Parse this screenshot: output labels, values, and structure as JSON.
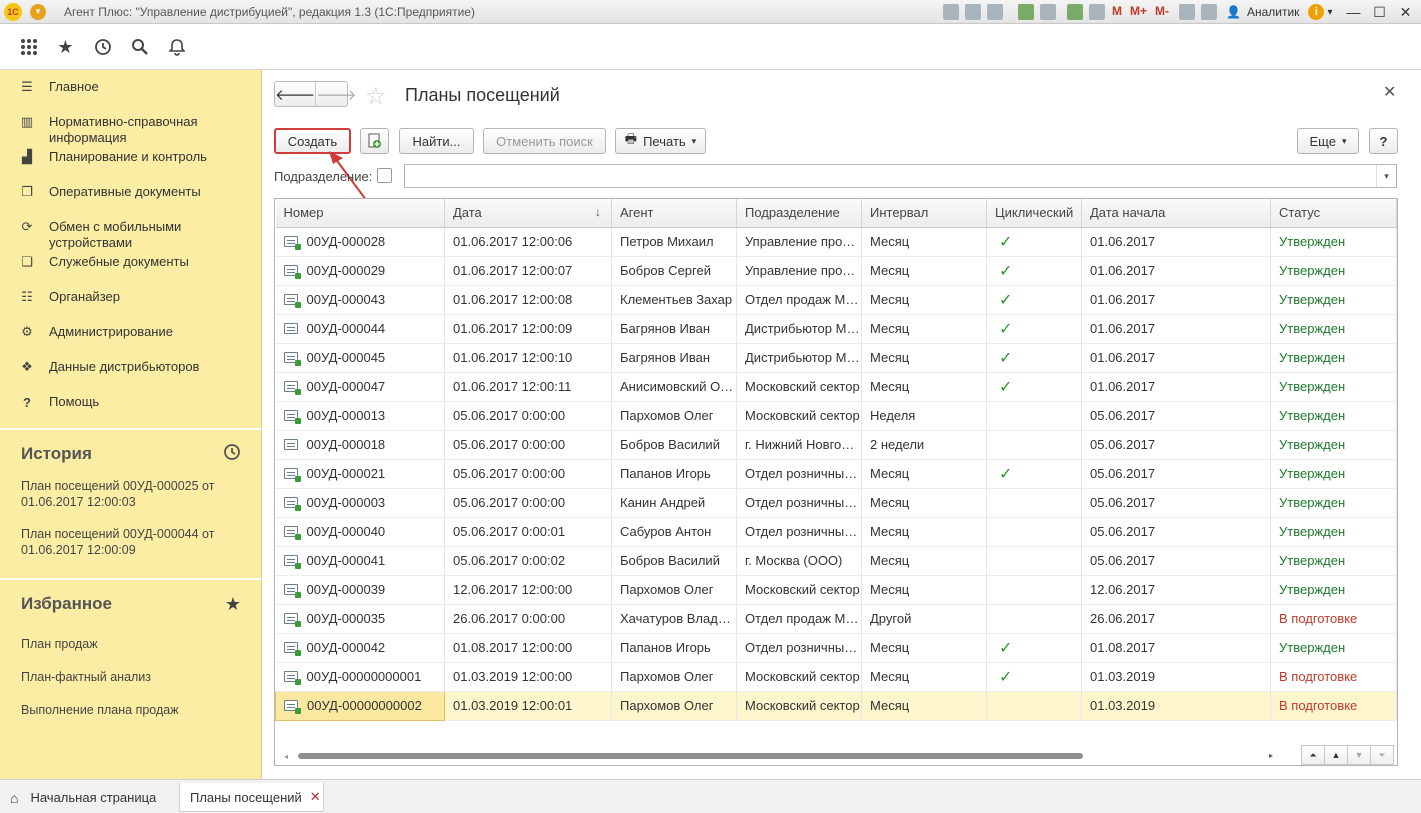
{
  "app": {
    "title": "Агент Плюс: \"Управление дистрибуцией\", редакция 1.3  (1С:Предприятие)",
    "user": "Аналитик",
    "m_labels": [
      "M",
      "M+",
      "M-"
    ]
  },
  "toppanel": {
    "icons": [
      "apps-grid-icon",
      "favorites-star-icon",
      "history-icon",
      "search-icon",
      "notifications-bell-icon"
    ]
  },
  "sidebar": {
    "items": [
      {
        "label": "Главное",
        "icon": "menu-lines-icon"
      },
      {
        "label": "Нормативно-справочная информация",
        "icon": "catalog-icon"
      },
      {
        "label": "Планирование и контроль",
        "icon": "bar-chart-icon"
      },
      {
        "label": "Оперативные документы",
        "icon": "documents-icon"
      },
      {
        "label": "Обмен с мобильными устройствами",
        "icon": "sync-icon"
      },
      {
        "label": "Служебные документы",
        "icon": "service-docs-icon"
      },
      {
        "label": "Органайзер",
        "icon": "organizer-icon"
      },
      {
        "label": "Администрирование",
        "icon": "gear-icon"
      },
      {
        "label": "Данные дистрибьюторов",
        "icon": "distributor-icon"
      },
      {
        "label": "Помощь",
        "icon": "help-icon"
      }
    ],
    "history": {
      "title": "История",
      "items": [
        "План посещений 00УД-000025 от 01.06.2017 12:00:03",
        "План посещений 00УД-000044 от 01.06.2017 12:00:09"
      ]
    },
    "favorites": {
      "title": "Избранное",
      "items": [
        "План продаж",
        "План-фактный анализ",
        "Выполнение плана продаж"
      ]
    }
  },
  "form": {
    "title": "Планы посещений",
    "buttons": {
      "create": "Создать",
      "find": "Найти...",
      "cancel_search": "Отменить поиск",
      "print": "Печать",
      "more": "Еще",
      "help": "?"
    },
    "filter_label": "Подразделение:",
    "filter_value": ""
  },
  "table": {
    "columns": [
      "Номер",
      "Дата",
      "Агент",
      "Подразделение",
      "Интервал",
      "Циклический",
      "Дата начала",
      "Статус"
    ],
    "rows": [
      {
        "num": "00УД-000028",
        "date": "01.06.2017 12:00:06",
        "agent": "Петров Михаил",
        "dept": "Управление продаж",
        "interval": "Месяц",
        "cyclic": true,
        "start": "01.06.2017",
        "status": "Утвержден",
        "posted": true
      },
      {
        "num": "00УД-000029",
        "date": "01.06.2017 12:00:07",
        "agent": "Бобров Сергей",
        "dept": "Управление продаж",
        "interval": "Месяц",
        "cyclic": true,
        "start": "01.06.2017",
        "status": "Утвержден",
        "posted": true
      },
      {
        "num": "00УД-000043",
        "date": "01.06.2017 12:00:08",
        "agent": "Клементьев Захар",
        "dept": "Отдел продаж Москва",
        "interval": "Месяц",
        "cyclic": true,
        "start": "01.06.2017",
        "status": "Утвержден",
        "posted": true
      },
      {
        "num": "00УД-000044",
        "date": "01.06.2017 12:00:09",
        "agent": "Багрянов Иван",
        "dept": "Дистрибьютор Москва",
        "interval": "Месяц",
        "cyclic": true,
        "start": "01.06.2017",
        "status": "Утвержден",
        "posted": false
      },
      {
        "num": "00УД-000045",
        "date": "01.06.2017 12:00:10",
        "agent": "Багрянов Иван",
        "dept": "Дистрибьютор Москва",
        "interval": "Месяц",
        "cyclic": true,
        "start": "01.06.2017",
        "status": "Утвержден",
        "posted": true
      },
      {
        "num": "00УД-000047",
        "date": "01.06.2017 12:00:11",
        "agent": "Анисимовский Олег",
        "dept": "Московский сектор",
        "interval": "Месяц",
        "cyclic": true,
        "start": "01.06.2017",
        "status": "Утвержден",
        "posted": true
      },
      {
        "num": "00УД-000013",
        "date": "05.06.2017 0:00:00",
        "agent": "Пархомов Олег",
        "dept": "Московский сектор",
        "interval": "Неделя",
        "cyclic": false,
        "start": "05.06.2017",
        "status": "Утвержден",
        "posted": true
      },
      {
        "num": "00УД-000018",
        "date": "05.06.2017 0:00:00",
        "agent": "Бобров Василий",
        "dept": "г. Нижний Новгород",
        "interval": "2 недели",
        "cyclic": false,
        "start": "05.06.2017",
        "status": "Утвержден",
        "posted": false
      },
      {
        "num": "00УД-000021",
        "date": "05.06.2017 0:00:00",
        "agent": "Папанов Игорь",
        "dept": "Отдел розничных продаж",
        "interval": "Месяц",
        "cyclic": true,
        "start": "05.06.2017",
        "status": "Утвержден",
        "posted": true
      },
      {
        "num": "00УД-000003",
        "date": "05.06.2017 0:00:00",
        "agent": "Канин Андрей",
        "dept": "Отдел розничных продаж",
        "interval": "Месяц",
        "cyclic": false,
        "start": "05.06.2017",
        "status": "Утвержден",
        "posted": true
      },
      {
        "num": "00УД-000040",
        "date": "05.06.2017 0:00:01",
        "agent": "Сабуров Антон",
        "dept": "Отдел розничных продаж",
        "interval": "Месяц",
        "cyclic": false,
        "start": "05.06.2017",
        "status": "Утвержден",
        "posted": true
      },
      {
        "num": "00УД-000041",
        "date": "05.06.2017 0:00:02",
        "agent": "Бобров Василий",
        "dept": "г. Москва  (ООО)",
        "interval": "Месяц",
        "cyclic": false,
        "start": "05.06.2017",
        "status": "Утвержден",
        "posted": true
      },
      {
        "num": "00УД-000039",
        "date": "12.06.2017 12:00:00",
        "agent": "Пархомов Олег",
        "dept": "Московский сектор",
        "interval": "Месяц",
        "cyclic": false,
        "start": "12.06.2017",
        "status": "Утвержден",
        "posted": true
      },
      {
        "num": "00УД-000035",
        "date": "26.06.2017 0:00:00",
        "agent": "Хачатуров Владимир",
        "dept": "Отдел продаж Москва",
        "interval": "Другой",
        "cyclic": false,
        "start": "26.06.2017",
        "status": "В подготовке",
        "posted": true
      },
      {
        "num": "00УД-000042",
        "date": "01.08.2017 12:00:00",
        "agent": "Папанов Игорь",
        "dept": "Отдел розничных продаж",
        "interval": "Месяц",
        "cyclic": true,
        "start": "01.08.2017",
        "status": "Утвержден",
        "posted": true
      },
      {
        "num": "00УД-00000000001",
        "date": "01.03.2019 12:00:00",
        "agent": "Пархомов Олег",
        "dept": "Московский сектор",
        "interval": "Месяц",
        "cyclic": true,
        "start": "01.03.2019",
        "status": "В подготовке",
        "posted": true
      },
      {
        "num": "00УД-00000000002",
        "date": "01.03.2019 12:00:01",
        "agent": "Пархомов Олег",
        "dept": "Московский сектор",
        "interval": "Месяц",
        "cyclic": false,
        "start": "01.03.2019",
        "status": "В подготовке",
        "posted": true,
        "selected": true
      }
    ]
  },
  "colors": {
    "sidebar_bg": "#fbeea4",
    "status_ok": "#1d7a2e",
    "status_draft": "#c0392b",
    "highlight": "#d23b3b"
  },
  "bottom_tabs": {
    "home": "Начальная страница",
    "active": "Планы посещений"
  }
}
